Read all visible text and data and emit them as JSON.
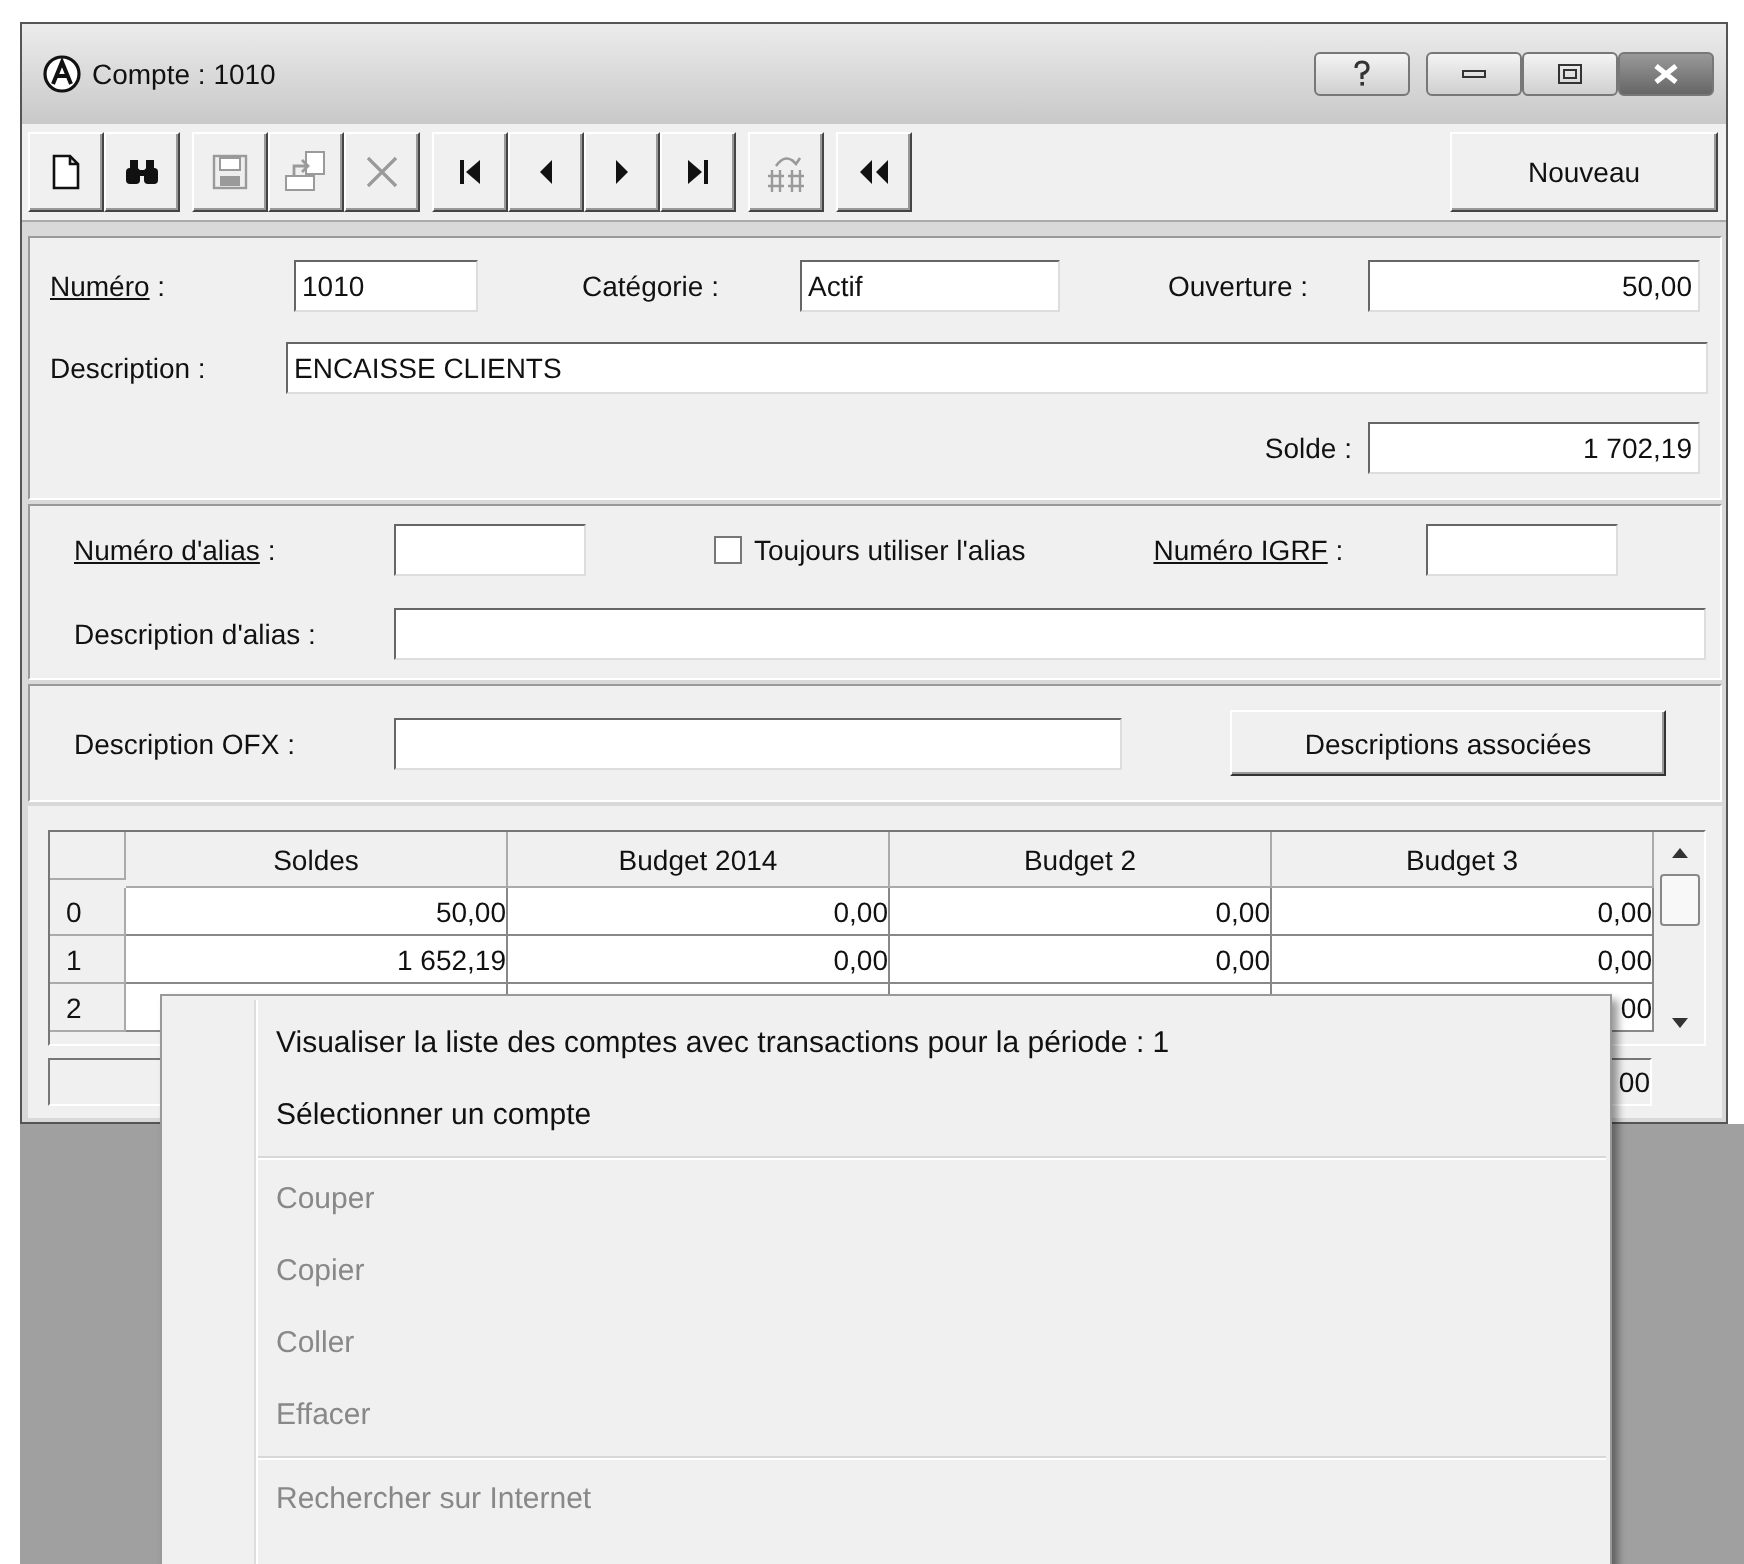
{
  "window": {
    "title": "Compte : 1010"
  },
  "title_buttons": [
    {
      "kind": "help"
    },
    {
      "kind": "minimize"
    },
    {
      "kind": "maximize"
    },
    {
      "kind": "close"
    }
  ],
  "toolbar": [
    {
      "kind": "new",
      "disabled": false
    },
    {
      "kind": "find",
      "disabled": false
    },
    {
      "kind": "save",
      "disabled": true
    },
    {
      "kind": "copy",
      "disabled": true
    },
    {
      "kind": "delete",
      "disabled": true
    },
    {
      "kind": "first",
      "disabled": false
    },
    {
      "kind": "previous",
      "disabled": false
    },
    {
      "kind": "next",
      "disabled": false
    },
    {
      "kind": "last",
      "disabled": false
    },
    {
      "kind": "renumber",
      "disabled": true
    },
    {
      "kind": "rewind",
      "disabled": false
    }
  ],
  "new_button": "Nouveau",
  "account": {
    "number": {
      "label": "Numéro",
      "colon": " :",
      "underlined": true,
      "value": "1010"
    },
    "category": {
      "label": "Catégorie :",
      "value": "Actif"
    },
    "opening": {
      "label": "Ouverture :",
      "value": "50,00"
    },
    "description": {
      "label": "Description :",
      "value": "ENCAISSE CLIENTS"
    },
    "balance": {
      "label": "Solde :",
      "value": "1 702,19"
    }
  },
  "alias": {
    "number": {
      "label": "Numéro d'alias",
      "colon": " :",
      "underlined": true
    },
    "always_use": {
      "label": "Toujours utiliser l'alias",
      "checked": false
    },
    "igrf": {
      "label": "Numéro IGRF",
      "colon": " :",
      "underlined": true
    },
    "description": {
      "label": "Description d'alias :"
    }
  },
  "ofx": {
    "label": "Description OFX :",
    "button": "Descriptions associées"
  },
  "grid": {
    "columns": [
      "Soldes",
      "Budget 2014",
      "Budget 2",
      "Budget 3"
    ],
    "rows": [
      {
        "index": "0",
        "cells": [
          "50,00",
          "0,00",
          "0,00",
          "0,00"
        ]
      },
      {
        "index": "1",
        "cells": [
          "1 652,19",
          "0,00",
          "0,00",
          "0,00"
        ]
      },
      {
        "index": "2",
        "cells": [
          "",
          "",
          "",
          "00"
        ]
      }
    ],
    "totals": [
      "00"
    ]
  },
  "context_menu": [
    {
      "kind": "item",
      "label": "Visualiser la liste des comptes avec transactions pour la période : 1",
      "disabled": false
    },
    {
      "kind": "item",
      "label": "Sélectionner un compte",
      "disabled": false
    },
    {
      "kind": "separator"
    },
    {
      "kind": "item",
      "label": "Couper",
      "disabled": true
    },
    {
      "kind": "item",
      "label": "Copier",
      "disabled": true
    },
    {
      "kind": "item",
      "label": "Coller",
      "disabled": true
    },
    {
      "kind": "item",
      "label": "Effacer",
      "disabled": true
    },
    {
      "kind": "separator"
    },
    {
      "kind": "item",
      "label": "Rechercher sur Internet",
      "disabled": true
    }
  ]
}
